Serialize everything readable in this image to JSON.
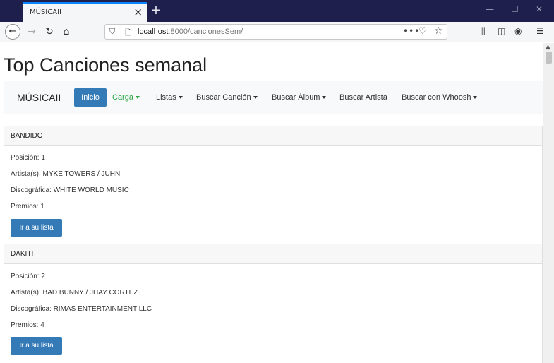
{
  "browser": {
    "tab_title": "MÚSICAII",
    "tab_close": "×",
    "new_tab": "+",
    "window_minimize": "—",
    "window_maximize": "☐",
    "window_close": "✕",
    "url_host": "localhost",
    "url_rest": ":8000/cancionesSem/",
    "url_more": "•••"
  },
  "page": {
    "title": "Top Canciones semanal"
  },
  "navbar": {
    "brand": "MÚSICAII",
    "inicio": "Inicio",
    "carga": "Carga",
    "listas": "Listas",
    "buscar_cancion": "Buscar Canción",
    "buscar_album": "Buscar Álbum",
    "buscar_artista": "Buscar Artista",
    "buscar_whoosh": "Buscar con Whoosh"
  },
  "songs": [
    {
      "name": "BANDIDO",
      "position": "Posición: 1",
      "artists": "Artista(s): MYKE TOWERS / JUHN",
      "label": "Discográfica: WHITE WORLD MUSIC",
      "awards": "Premios: 1",
      "button": "Ir a su lista"
    },
    {
      "name": "DAKITI",
      "position": "Posición: 2",
      "artists": "Artista(s): BAD BUNNY / JHAY CORTEZ",
      "label": "Discográfica: RIMAS ENTERTAINMENT LLC",
      "awards": "Premios: 4",
      "button": "Ir a su lista"
    }
  ],
  "icons": {
    "back": "back-arrow-icon",
    "forward": "forward-arrow-icon",
    "reload": "reload-icon",
    "home": "home-icon",
    "shield": "shield-icon",
    "page": "page-icon",
    "pocket": "pocket-icon",
    "star": "bookmark-star-icon",
    "library": "library-icon",
    "sidebar": "sidebar-icon",
    "account": "account-icon",
    "menu": "hamburger-menu-icon"
  },
  "colors": {
    "titlebar": "#1f1f4d",
    "primary": "#337ab7",
    "carga_link": "#28a745",
    "navbar_bg": "#f8f9fa"
  }
}
